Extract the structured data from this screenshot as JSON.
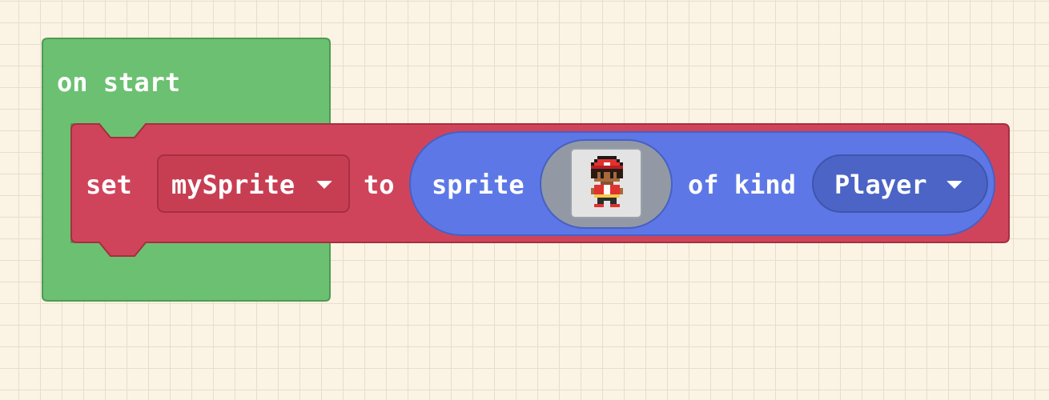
{
  "colors": {
    "workspace_bg": "#fbf3e3",
    "grid": "#e7ddcb",
    "event_block": "#6cc072",
    "variable_block": "#d0445b",
    "sprite_block": "#5d78e6",
    "sprite_kind_dropdown": "#4b64c6",
    "image_field": "#9299a4"
  },
  "on_start_block": {
    "label": "on start"
  },
  "set_block": {
    "set_label": "set",
    "variable": "mySprite",
    "to_label": "to"
  },
  "sprite_block": {
    "label": "sprite",
    "image_icon": "player-character-icon",
    "of_kind_label": "of kind",
    "kind": "Player"
  }
}
